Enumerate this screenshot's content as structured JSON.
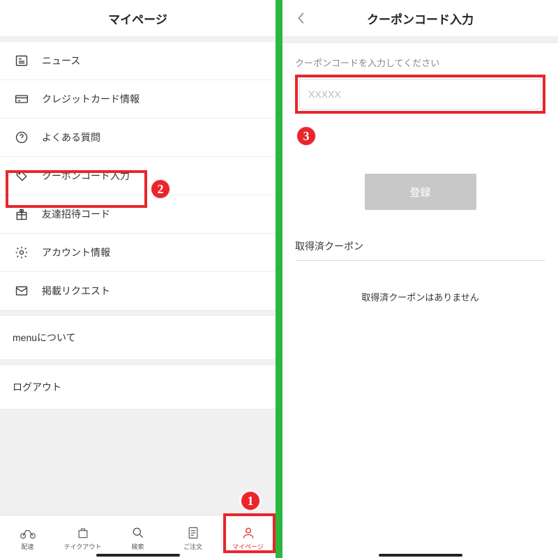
{
  "left": {
    "title": "マイページ",
    "menu": [
      {
        "icon": "news",
        "label": "ニュース"
      },
      {
        "icon": "card",
        "label": "クレジットカード情報"
      },
      {
        "icon": "help",
        "label": "よくある質問"
      },
      {
        "icon": "tag",
        "label": "クーポンコード入力"
      },
      {
        "icon": "gift",
        "label": "友達招待コード"
      },
      {
        "icon": "gear",
        "label": "アカウント情報"
      },
      {
        "icon": "mail",
        "label": "掲載リクエスト"
      }
    ],
    "secondary": [
      {
        "label": "menuについて"
      },
      {
        "label": "ログアウト"
      }
    ],
    "nav": [
      {
        "icon": "bike",
        "label": "配達"
      },
      {
        "icon": "bag",
        "label": "テイクアウト"
      },
      {
        "icon": "search",
        "label": "検索"
      },
      {
        "icon": "order",
        "label": "ご注文"
      },
      {
        "icon": "user",
        "label": "マイページ",
        "active": true
      }
    ]
  },
  "right": {
    "title": "クーポンコード入力",
    "form_label": "クーポンコードを入力してください",
    "placeholder": "XXXXX",
    "submit": "登録",
    "section_title": "取得済クーポン",
    "empty_text": "取得済クーポンはありません"
  },
  "annotations": {
    "badge1": "1",
    "badge2": "2",
    "badge3": "3"
  },
  "colors": {
    "accent_red": "#E8262C",
    "divider_green": "#2CB742"
  }
}
